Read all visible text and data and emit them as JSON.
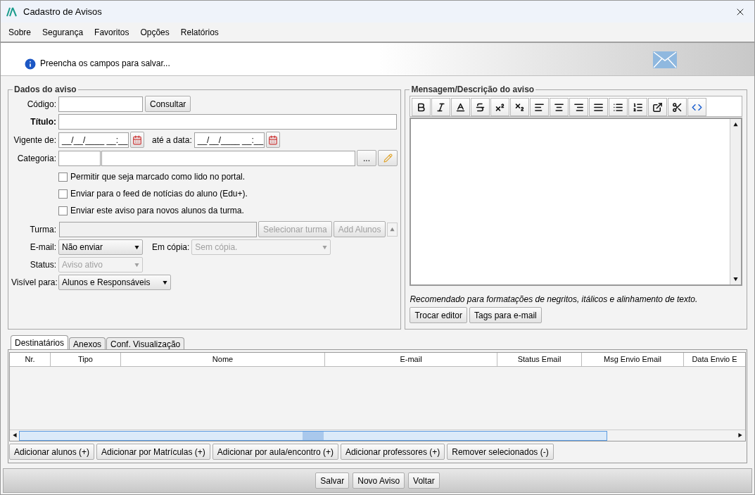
{
  "window": {
    "title": "Cadastro de Avisos"
  },
  "menu": [
    "Sobre",
    "Segurança",
    "Favoritos",
    "Opções",
    "Relatórios"
  ],
  "info_banner": {
    "message": "Preencha os campos para salvar..."
  },
  "dados_do_aviso": {
    "title": "Dados do aviso",
    "codigo": {
      "label": "Código:",
      "button": "Consultar"
    },
    "titulo": {
      "label": "Título:"
    },
    "vigente": {
      "label": "Vigente de:",
      "value": "__/__/____ __:__",
      "until_label": "até a data:",
      "until_value": "__/__/____ __:__"
    },
    "categoria": {
      "label": "Categoria:",
      "browse_button": "..."
    },
    "checkboxes": [
      {
        "label": "Permitir que seja marcado como lido no portal.",
        "checked": false
      },
      {
        "label": "Enviar para o feed de notícias do aluno (Edu+).",
        "checked": false
      },
      {
        "label": "Enviar este aviso para novos alunos da turma.",
        "checked": false
      }
    ],
    "turma": {
      "label": "Turma:",
      "disabled": true,
      "select_button": "Selecionar turma",
      "add_button": "Add Alunos"
    },
    "email": {
      "label": "E-mail:",
      "value": "Não enviar",
      "disabled": false,
      "copy_label": "Em cópia:",
      "copy_value": "Sem cópia.",
      "copy_disabled": true
    },
    "status": {
      "label": "Status:",
      "value": "Aviso ativo",
      "disabled": true
    },
    "visivel": {
      "label": "Visível para:",
      "value": "Alunos e Responsáveis",
      "disabled": false
    }
  },
  "mensagem": {
    "title": "Mensagem/Descrição do aviso",
    "hint": "Recomendado para formatações de negritos, itálicos e alinhamento de texto.",
    "buttons": [
      "Trocar editor",
      "Tags para e-mail"
    ]
  },
  "tabs": [
    {
      "label": "Destinatários",
      "selected": true
    },
    {
      "label": "Anexos",
      "selected": false
    },
    {
      "label": "Conf. Visualização",
      "selected": false
    }
  ],
  "table": {
    "columns": [
      "Nr.",
      "Tipo",
      "Nome",
      "E-mail",
      "Status Email",
      "Msg Envio Email",
      "Data Envio E"
    ]
  },
  "table_buttons": [
    "Adicionar alunos (+)",
    "Adicionar por Matrículas (+)",
    "Adicionar por aula/encontro (+)",
    "Adicionar professores (+)",
    "Remover selecionados (-)"
  ],
  "footer_buttons": [
    "Salvar",
    "Novo Aviso",
    "Voltar"
  ]
}
